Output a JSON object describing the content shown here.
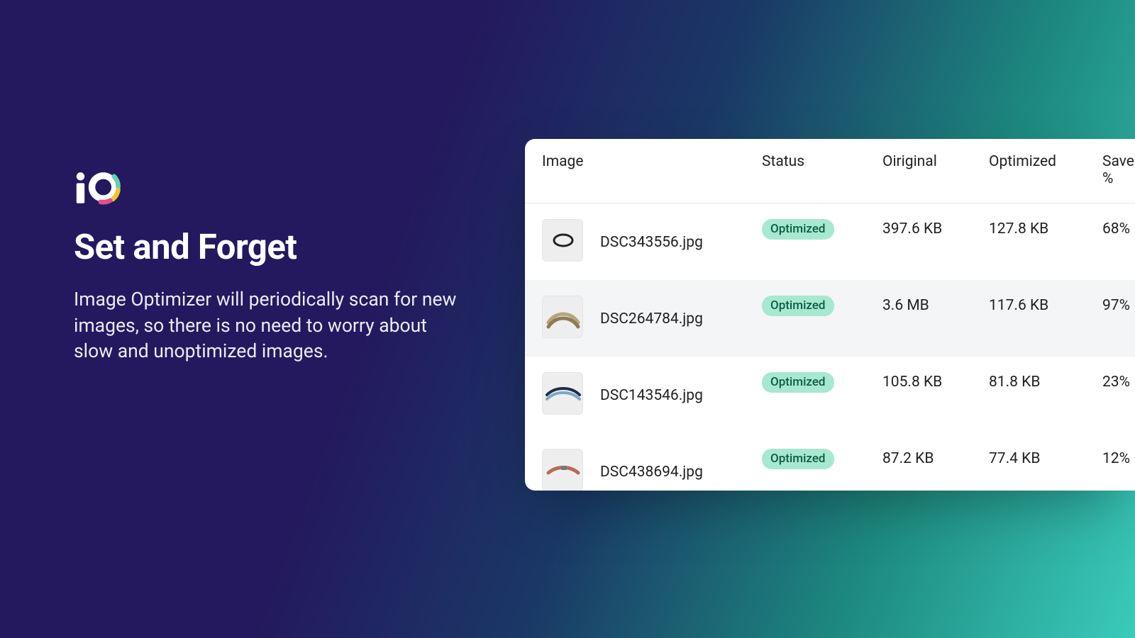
{
  "hero": {
    "title": "Set and Forget",
    "subtitle": "Image Optimizer will periodically scan for new images, so there is no need to worry about slow and unoptimized images."
  },
  "table": {
    "headers": {
      "image": "Image",
      "status": "Status",
      "original": "Oiriginal",
      "optimized": "Optimized",
      "saved": "Saved %"
    },
    "badge_label": "Optimized",
    "rows": [
      {
        "filename": "DSC343556.jpg",
        "status": "Optimized",
        "original": "397.6 KB",
        "optimized": "127.8 KB",
        "saved": "68%",
        "shape": "ring",
        "alt": false
      },
      {
        "filename": "DSC264784.jpg",
        "status": "Optimized",
        "original": "3.6 MB",
        "optimized": "117.6 KB",
        "saved": "97%",
        "shape": "strap",
        "alt": true
      },
      {
        "filename": "DSC143546.jpg",
        "status": "Optimized",
        "original": "105.8 KB",
        "optimized": "81.8 KB",
        "saved": "23%",
        "shape": "bracelet",
        "alt": false
      },
      {
        "filename": "DSC438694.jpg",
        "status": "Optimized",
        "original": "87.2 KB",
        "optimized": "77.4 KB",
        "saved": "12%",
        "shape": "band",
        "alt": false
      }
    ]
  },
  "icons": {
    "logo": "io-logo-icon"
  }
}
